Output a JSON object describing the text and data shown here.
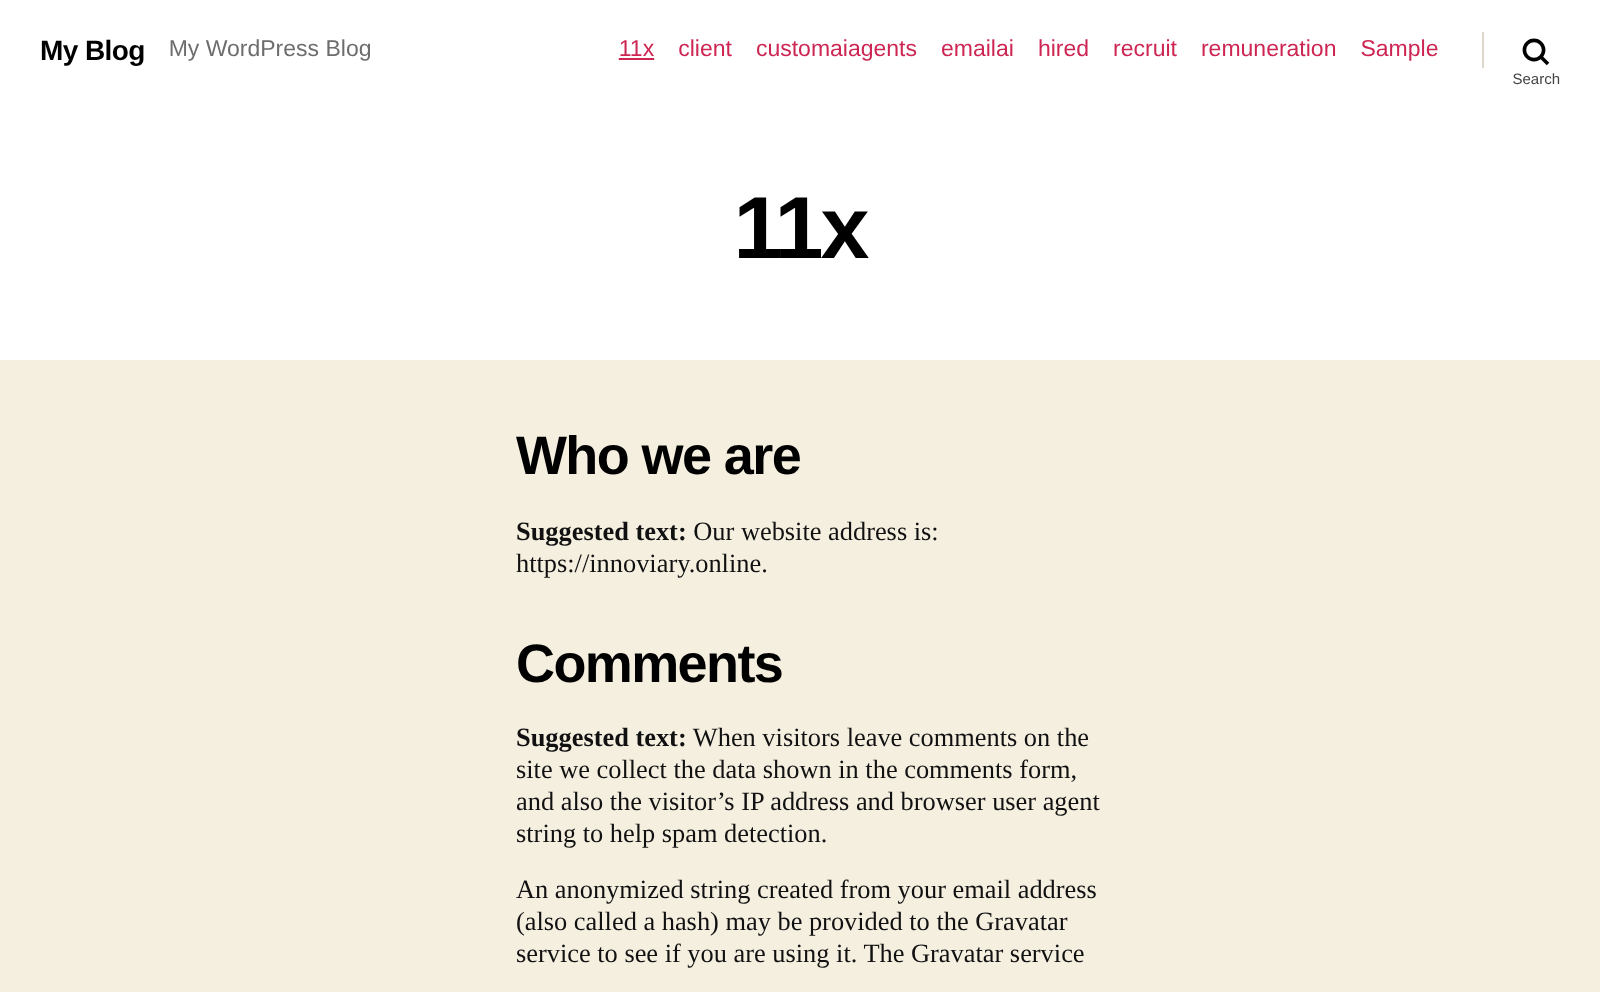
{
  "header": {
    "site_title": "My Blog",
    "tagline": "My WordPress Blog",
    "nav": [
      {
        "label": "11x",
        "selected": true
      },
      {
        "label": "client",
        "selected": false
      },
      {
        "label": "customaiagents",
        "selected": false
      },
      {
        "label": "emailai",
        "selected": false
      },
      {
        "label": "hired",
        "selected": false
      },
      {
        "label": "recruit",
        "selected": false
      },
      {
        "label": "remuneration",
        "selected": false
      },
      {
        "label": "Sample",
        "selected": false
      }
    ],
    "search_label": "Search"
  },
  "page_title": "11x",
  "sections": [
    {
      "heading": "Who we are",
      "paragraphs": [
        "**Suggested text:** Our website address is: https://innoviary.online."
      ]
    },
    {
      "heading": "Comments",
      "paragraphs": [
        "**Suggested text:** When visitors leave comments on the site we collect the data shown in the comments form, and also the visitor’s IP address and browser user agent string to help spam detection.",
        "An anonymized string created from your email address (also called a hash) may be provided to the Gravatar service to see if you are using it. The Gravatar service"
      ]
    }
  ]
}
